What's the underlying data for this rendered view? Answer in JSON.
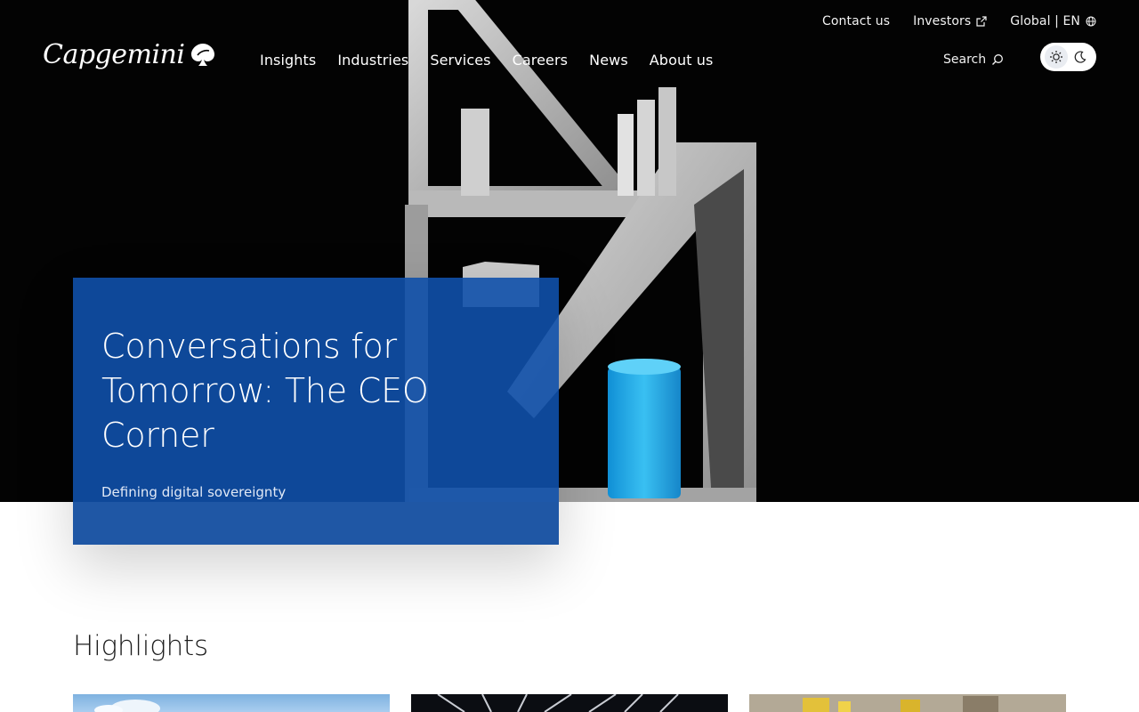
{
  "utility": {
    "contact": "Contact us",
    "investors": "Investors",
    "locale": "Global | EN"
  },
  "brand": {
    "logo_text": "Capgemini"
  },
  "nav": {
    "items": [
      {
        "label": "Insights"
      },
      {
        "label": "Industries"
      },
      {
        "label": "Services"
      },
      {
        "label": "Careers"
      },
      {
        "label": "News"
      },
      {
        "label": "About us"
      }
    ]
  },
  "search": {
    "label": "Search"
  },
  "theme": {
    "light_icon": "sun-icon",
    "dark_icon": "moon-icon",
    "active": "light"
  },
  "hero": {
    "title": "Conversations for Tomorrow: The CEO Corner",
    "subtitle": "Defining digital sovereignty"
  },
  "highlights": {
    "title": "Highlights",
    "cards": [
      {
        "image": "sky-building-image"
      },
      {
        "image": "turbine-image"
      },
      {
        "image": "street-image"
      }
    ]
  },
  "colors": {
    "hero_card": "#1051aa",
    "accent_cyan": "#20a6e6",
    "hero_background": "#030303"
  }
}
